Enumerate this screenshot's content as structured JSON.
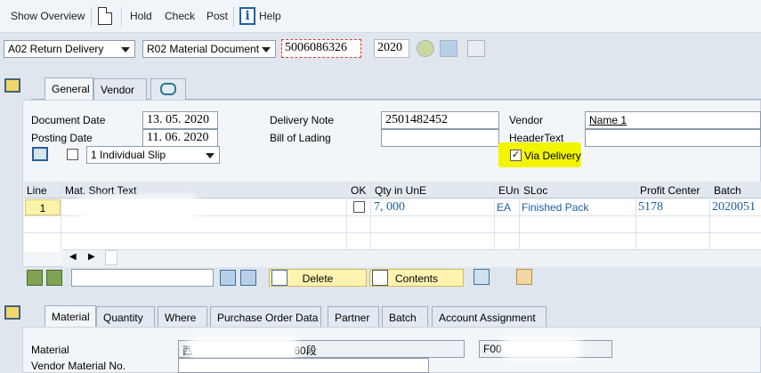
{
  "toolbar": {
    "show_overview": "Show Overview",
    "hold": "Hold",
    "check": "Check",
    "post": "Post",
    "help": "Help",
    "info_glyph": "i"
  },
  "selectors": {
    "action": "A02 Return Delivery",
    "reference": "R02 Material Document",
    "doc_number": "5006086326",
    "year": "2020"
  },
  "header_tabs": [
    "General",
    "Vendor"
  ],
  "general": {
    "document_date_label": "Document Date",
    "document_date": "13. 05. 2020",
    "posting_date_label": "Posting Date",
    "posting_date": "11. 06. 2020",
    "slip_option": "1 Individual Slip",
    "delivery_note_label": "Delivery Note",
    "delivery_note": "2501482452",
    "bill_of_lading_label": "Bill of Lading",
    "bill_of_lading": "",
    "vendor_label": "Vendor",
    "vendor_value": "Name 1",
    "header_text_label": "HeaderText",
    "header_text": "",
    "via_delivery_label": "Via Delivery",
    "via_delivery_checked": "✓"
  },
  "items_table": {
    "columns": [
      "Line",
      "Mat. Short Text",
      "OK",
      "Qty in UnE",
      "EUn",
      "SLoc",
      "Profit Center",
      "Batch"
    ],
    "rows": [
      {
        "line": "1",
        "qty": "7, 000",
        "eun": "EA",
        "sloc": "Finished Pack",
        "profit_center": "5178",
        "batch": "2020051"
      }
    ]
  },
  "item_actions": {
    "delete": "Delete",
    "contents": "Contents"
  },
  "detail_tabs": [
    "Material",
    "Quantity",
    "Where",
    "Purchase Order Data",
    "Partner",
    "Batch",
    "Account Assignment"
  ],
  "material_detail": {
    "material_label": "Material",
    "material_value_suffix": "60段",
    "material_prefix": "西",
    "plant_prefix": "F00",
    "vendor_material_label": "Vendor Material No."
  },
  "colors": {
    "highlight": "#f3f500",
    "accent_blue": "#1d5fa5",
    "button_yellow": "#fff3b0"
  }
}
